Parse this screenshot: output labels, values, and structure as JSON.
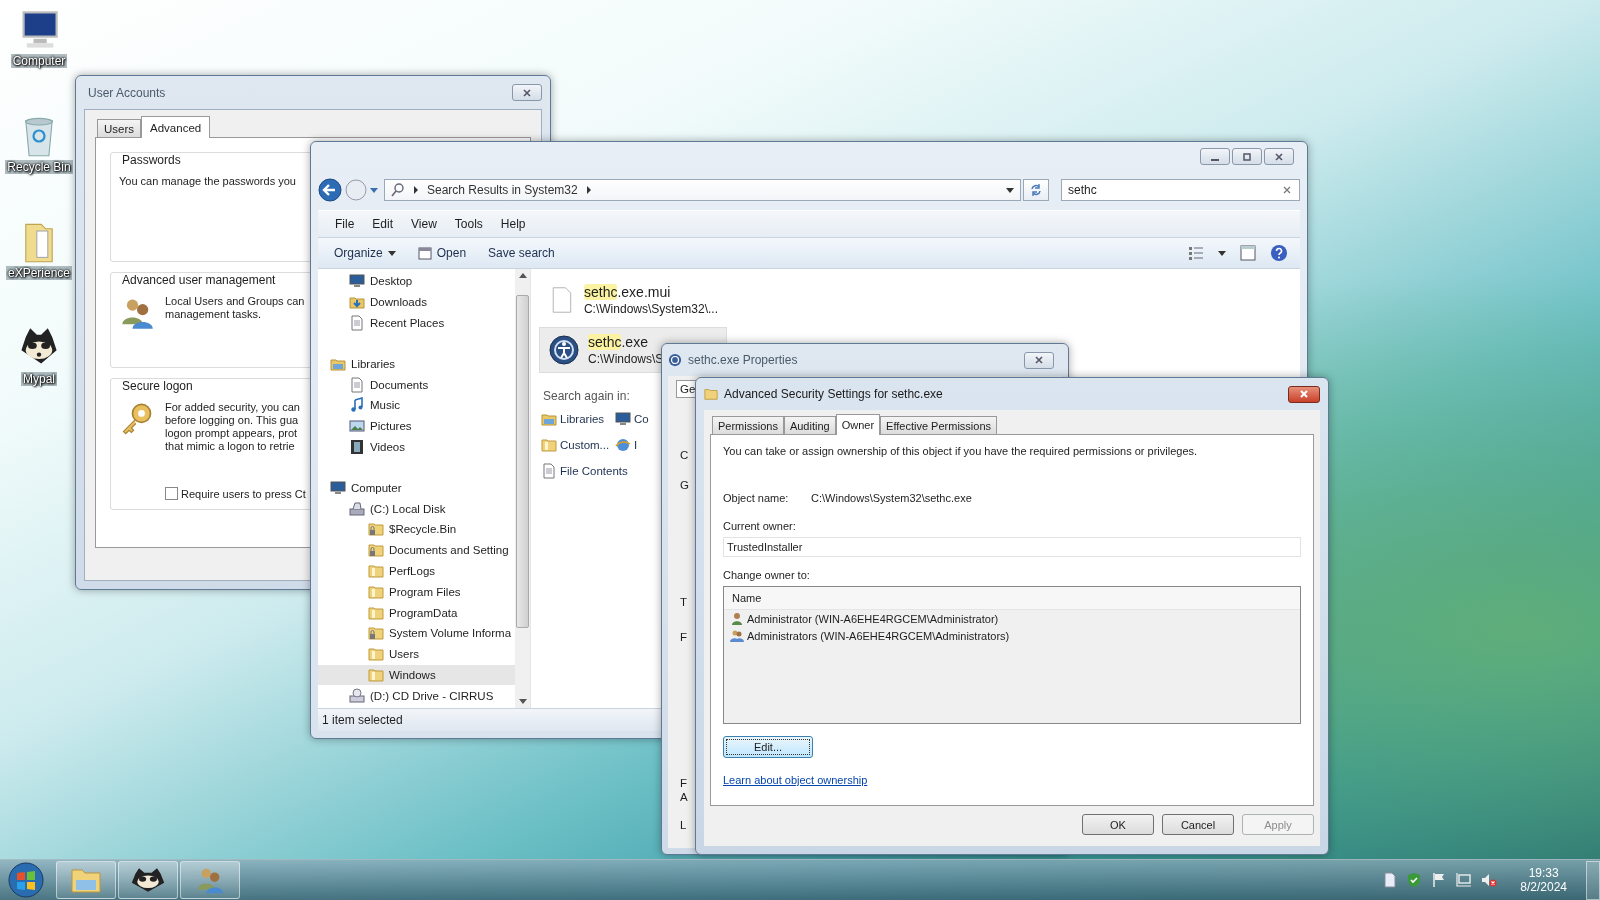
{
  "desktop_icons": [
    {
      "label": "Computer",
      "kind": "computer"
    },
    {
      "label": "Recycle Bin",
      "kind": "bin"
    },
    {
      "label": "eXPerience",
      "kind": "folder"
    },
    {
      "label": "Mypal",
      "kind": "raccoon"
    }
  ],
  "user_accounts": {
    "title": "User Accounts",
    "tabs": [
      {
        "label": "Users",
        "selected": false
      },
      {
        "label": "Advanced",
        "selected": true
      }
    ],
    "sections": [
      {
        "title": "Passwords",
        "lines": [
          "You can manage the passwords you"
        ]
      },
      {
        "title": "Advanced user management",
        "lines": [
          "Local Users and Groups can",
          "management tasks."
        ]
      },
      {
        "title": "Secure logon",
        "lines": [
          "For added security, you can",
          "before logging on. This gua",
          "logon prompt appears, prot",
          "that mimic a logon to retrie"
        ],
        "checkbox": {
          "label": "Require users to press Ct",
          "checked": false
        }
      }
    ]
  },
  "explorer": {
    "address": "Search Results in System32",
    "search": "sethc",
    "menu": [
      "File",
      "Edit",
      "View",
      "Tools",
      "Help"
    ],
    "toolbar": [
      "Organize",
      "Open",
      "Save search"
    ],
    "nav_tree": [
      {
        "label": "Desktop",
        "kind": "desktop",
        "selected": false
      },
      {
        "label": "Downloads",
        "kind": "downloads",
        "selected": false
      },
      {
        "label": "Recent Places",
        "kind": "recent",
        "selected": false
      },
      {
        "label": "Libraries",
        "kind": "library",
        "selected": false,
        "children": [
          {
            "label": "Documents",
            "kind": "document",
            "selected": false
          },
          {
            "label": "Music",
            "kind": "music",
            "selected": false
          },
          {
            "label": "Pictures",
            "kind": "picture",
            "selected": false
          },
          {
            "label": "Videos",
            "kind": "video",
            "selected": false
          }
        ]
      },
      {
        "label": "Computer",
        "kind": "computer",
        "selected": false,
        "children": [
          {
            "label": "(C:) Local Disk",
            "kind": "drive",
            "selected": false,
            "children": [
              {
                "label": "$Recycle.Bin",
                "kind": "locked-folder",
                "selected": false
              },
              {
                "label": "Documents and Setting",
                "kind": "locked-folder",
                "selected": false
              },
              {
                "label": "PerfLogs",
                "kind": "folder",
                "selected": false
              },
              {
                "label": "Program Files",
                "kind": "folder",
                "selected": false
              },
              {
                "label": "ProgramData",
                "kind": "folder",
                "selected": false
              },
              {
                "label": "System Volume Informa",
                "kind": "locked-folder",
                "selected": false
              },
              {
                "label": "Users",
                "kind": "folder",
                "selected": false
              },
              {
                "label": "Windows",
                "kind": "folder",
                "selected": true
              }
            ]
          },
          {
            "label": "(D:) CD Drive - CIRRUS",
            "kind": "cd-drive",
            "selected": false
          }
        ]
      }
    ],
    "results": [
      {
        "match": "sethc",
        "rest": ".exe.mui",
        "path": "C:\\Windows\\System32\\...",
        "kind": "file",
        "selected": false
      },
      {
        "match": "sethc",
        "rest": ".exe",
        "path": "C:\\Windows\\S",
        "kind": "app",
        "selected": true
      }
    ],
    "search_again": {
      "label": "Search again in:",
      "options": [
        {
          "label": "Libraries",
          "kind": "library"
        },
        {
          "label": "Co",
          "kind": "computer"
        },
        {
          "label": "Custom...",
          "kind": "folder"
        },
        {
          "label": "I",
          "kind": "globe"
        },
        {
          "label": "File Contents",
          "kind": "document"
        }
      ]
    },
    "status": "1 item selected"
  },
  "properties": {
    "title": "sethc.exe Properties",
    "tab": "Ge",
    "fragments": [
      "C",
      "G",
      "T",
      "F",
      "F",
      "A",
      "L"
    ]
  },
  "advanced": {
    "title": "Advanced Security Settings for sethc.exe",
    "tabs": [
      {
        "label": "Permissions",
        "selected": false
      },
      {
        "label": "Auditing",
        "selected": false
      },
      {
        "label": "Owner",
        "selected": true
      },
      {
        "label": "Effective Permissions",
        "selected": false
      }
    ],
    "intro": "You can take or assign ownership of this object if you have the required permissions or privileges.",
    "object_name_label": "Object name:",
    "object_name": "C:\\Windows\\System32\\sethc.exe",
    "current_owner_label": "Current owner:",
    "current_owner": "TrustedInstaller",
    "change_owner_label": "Change owner to:",
    "column": "Name",
    "owners": [
      {
        "name": "Administrator (WIN-A6EHE4RGCEM\\Administrator)",
        "kind": "user"
      },
      {
        "name": "Administrators (WIN-A6EHE4RGCEM\\Administrators)",
        "kind": "group"
      }
    ],
    "edit_button": "Edit...",
    "link": "Learn about object ownership",
    "buttons": [
      {
        "label": "OK",
        "disabled": false
      },
      {
        "label": "Cancel",
        "disabled": false
      },
      {
        "label": "Apply",
        "disabled": true
      }
    ]
  },
  "taskbar": {
    "time": "19:33",
    "date": "8/2/2024"
  }
}
